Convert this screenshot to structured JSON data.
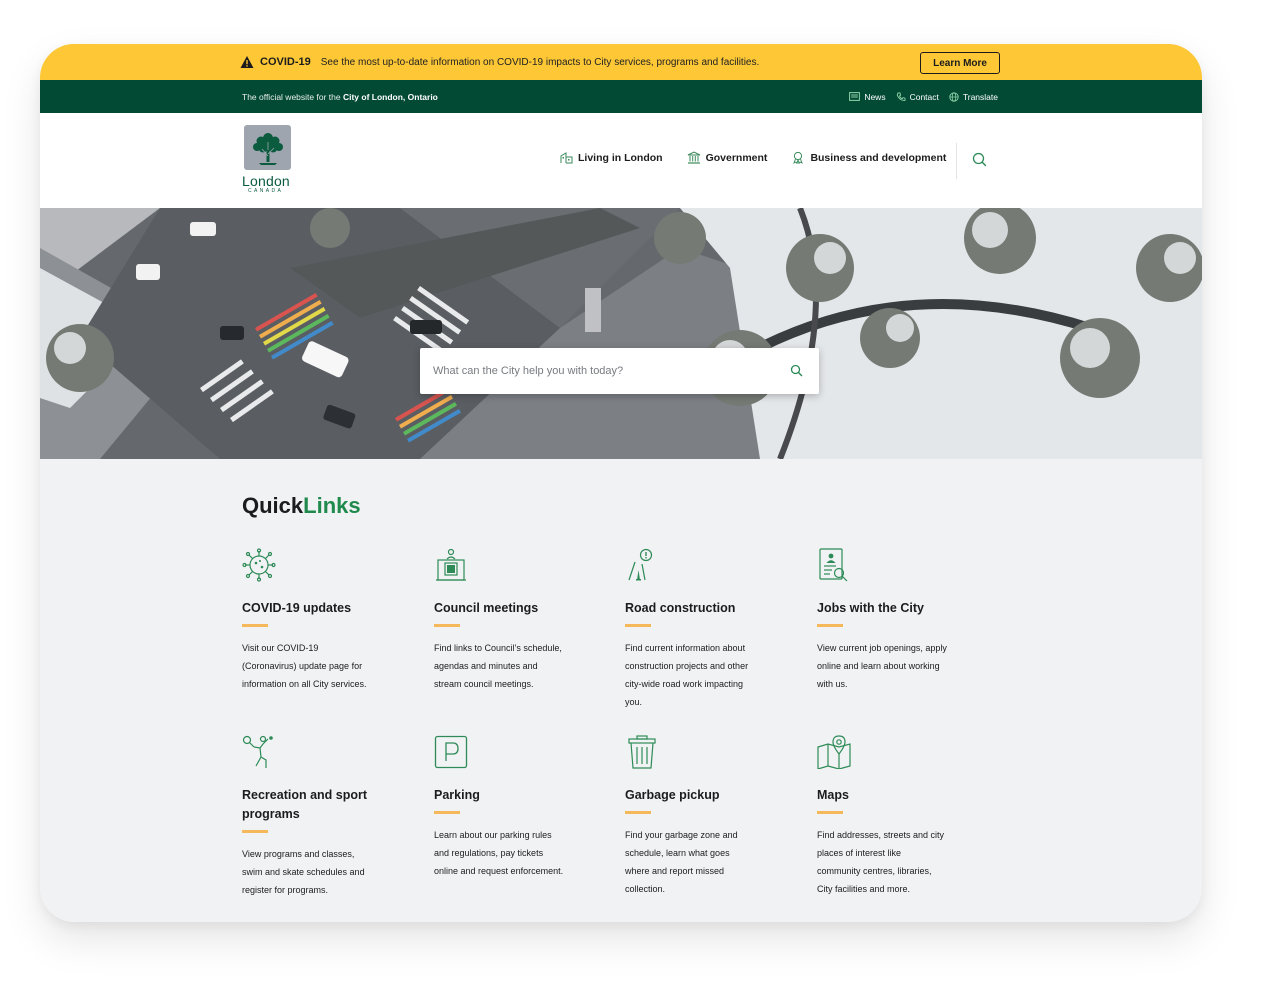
{
  "alert": {
    "label": "COVID-19",
    "message": "See the most up-to-date information on COVID-19 impacts to City services, programs and facilities.",
    "button_label": "Learn More"
  },
  "utility": {
    "official_prefix": "The official website for the",
    "official_city": "City of London, Ontario",
    "links": [
      {
        "label": "News",
        "icon": "news-icon"
      },
      {
        "label": "Contact",
        "icon": "phone-icon"
      },
      {
        "label": "Translate",
        "icon": "globe-icon"
      }
    ]
  },
  "logo": {
    "word": "London",
    "sub": "CANADA",
    "icon": "tree-icon"
  },
  "nav": {
    "items": [
      {
        "label": "Living in London",
        "icon": "building-icon"
      },
      {
        "label": "Government",
        "icon": "government-icon"
      },
      {
        "label": "Business and development",
        "icon": "handshake-icon"
      }
    ],
    "search_icon": "search-icon"
  },
  "hero": {
    "search_placeholder": "What can the City help you with today?"
  },
  "quicklinks": {
    "title_part1": "Quick",
    "title_part2": "Links",
    "items": [
      {
        "title": "COVID-19 updates",
        "desc": "Visit our COVID-19 (Coronavirus) update page for information on all City services.",
        "icon": "virus-icon"
      },
      {
        "title": "Council meetings",
        "desc": "Find links to Council’s schedule, agendas and minutes and stream council meetings.",
        "icon": "podium-icon"
      },
      {
        "title": "Road construction",
        "desc": "Find current information about construction projects and other city-wide road work impacting you.",
        "icon": "road-work-icon"
      },
      {
        "title": "Jobs with the City",
        "desc": "View current job openings, apply online and learn about working with us.",
        "icon": "job-search-icon"
      },
      {
        "title": "Recreation and sport programs",
        "desc": "View programs and classes, swim and skate schedules and register for programs.",
        "icon": "tennis-player-icon"
      },
      {
        "title": "Parking",
        "desc": "Learn about our parking rules and regulations, pay tickets online and request enforcement.",
        "icon": "parking-icon"
      },
      {
        "title": "Garbage pickup",
        "desc": "Find your garbage zone and schedule, learn what goes where and report missed collection.",
        "icon": "trash-bin-icon"
      },
      {
        "title": "Maps",
        "desc": "Find addresses, streets and city places of interest like community centres, libraries, City facilities and more.",
        "icon": "map-pin-icon"
      }
    ]
  },
  "colors": {
    "alert_yellow": "#fdc735",
    "brand_dark_green": "#034a35",
    "accent_green": "#1f8a4c",
    "underline_orange": "#f5b95c"
  }
}
